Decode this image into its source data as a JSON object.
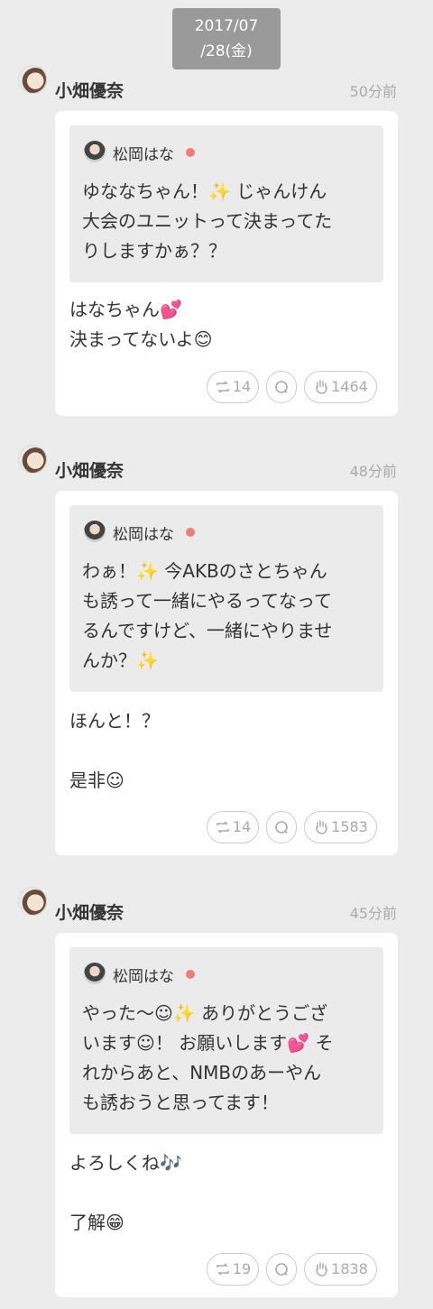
{
  "date_badge": {
    "line1": "2017/07",
    "line2": "/28(金)"
  },
  "posts": [
    {
      "author": "小畑優奈",
      "time": "50分前",
      "quote": {
        "name": "松岡はな",
        "lines": [
          "ゆななちゃん！✨ じゃんけん",
          "大会のユニットって決まってた",
          "りしますかぁ？？"
        ]
      },
      "reply_lines": [
        "はなちゃん💕",
        "決まってないよ😊"
      ],
      "retweet_count": "14",
      "clap_count": "1464"
    },
    {
      "author": "小畑優奈",
      "time": "48分前",
      "quote": {
        "name": "松岡はな",
        "lines": [
          "わぁ！✨ 今AKBのさとちゃん",
          "も誘って一緒にやるってなって",
          "るんですけど、一緒にやりませ",
          "んか？✨"
        ]
      },
      "reply_lines": [
        "ほんと！？",
        "",
        "是非☺"
      ],
      "retweet_count": "14",
      "clap_count": "1583"
    },
    {
      "author": "小畑優奈",
      "time": "45分前",
      "quote": {
        "name": "松岡はな",
        "lines": [
          "やった〜☺✨ ありがとうござ",
          "います☺！ お願いします💕 そ",
          "れからあと、NMBのあーやん",
          "も誘おうと思ってます！"
        ]
      },
      "reply_lines": [
        "よろしくね🎶",
        "",
        "了解😁"
      ],
      "retweet_count": "19",
      "clap_count": "1838"
    }
  ]
}
